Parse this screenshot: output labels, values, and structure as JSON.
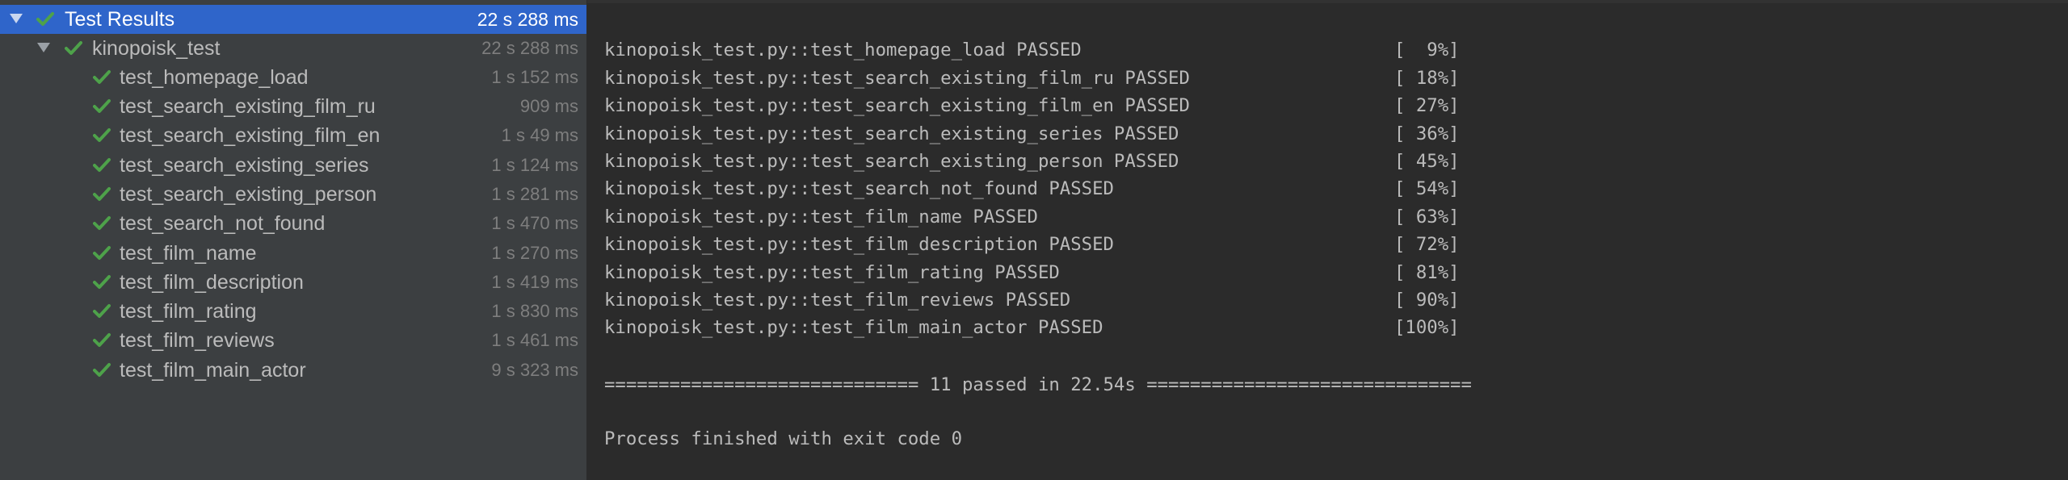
{
  "tree": {
    "root": {
      "label": "Test Results",
      "time": "22 s 288 ms"
    },
    "suite": {
      "label": "kinopoisk_test",
      "time": "22 s 288 ms"
    },
    "tests": [
      {
        "label": "test_homepage_load",
        "time": "1 s 152 ms"
      },
      {
        "label": "test_search_existing_film_ru",
        "time": "909 ms"
      },
      {
        "label": "test_search_existing_film_en",
        "time": "1 s 49 ms"
      },
      {
        "label": "test_search_existing_series",
        "time": "1 s 124 ms"
      },
      {
        "label": "test_search_existing_person",
        "time": "1 s 281 ms"
      },
      {
        "label": "test_search_not_found",
        "time": "1 s 470 ms"
      },
      {
        "label": "test_film_name",
        "time": "1 s 270 ms"
      },
      {
        "label": "test_film_description",
        "time": "1 s 419 ms"
      },
      {
        "label": "test_film_rating",
        "time": "1 s 830 ms"
      },
      {
        "label": "test_film_reviews",
        "time": "1 s 461 ms"
      },
      {
        "label": "test_film_main_actor",
        "time": "9 s 323 ms"
      }
    ]
  },
  "console": {
    "lines": [
      {
        "text": "kinopoisk_test.py::test_homepage_load PASSED",
        "pct": "[  9%]"
      },
      {
        "text": "kinopoisk_test.py::test_search_existing_film_ru PASSED",
        "pct": "[ 18%]"
      },
      {
        "text": "kinopoisk_test.py::test_search_existing_film_en PASSED",
        "pct": "[ 27%]"
      },
      {
        "text": "kinopoisk_test.py::test_search_existing_series PASSED",
        "pct": "[ 36%]"
      },
      {
        "text": "kinopoisk_test.py::test_search_existing_person PASSED",
        "pct": "[ 45%]"
      },
      {
        "text": "kinopoisk_test.py::test_search_not_found PASSED",
        "pct": "[ 54%]"
      },
      {
        "text": "kinopoisk_test.py::test_film_name PASSED",
        "pct": "[ 63%]"
      },
      {
        "text": "kinopoisk_test.py::test_film_description PASSED",
        "pct": "[ 72%]"
      },
      {
        "text": "kinopoisk_test.py::test_film_rating PASSED",
        "pct": "[ 81%]"
      },
      {
        "text": "kinopoisk_test.py::test_film_reviews PASSED",
        "pct": "[ 90%]"
      },
      {
        "text": "kinopoisk_test.py::test_film_main_actor PASSED",
        "pct": "[100%]"
      }
    ],
    "summary": "============================= 11 passed in 22.54s ==============================",
    "exit": "Process finished with exit code 0"
  },
  "colors": {
    "check": "#4ea24a",
    "selected": "#2f65ca"
  }
}
